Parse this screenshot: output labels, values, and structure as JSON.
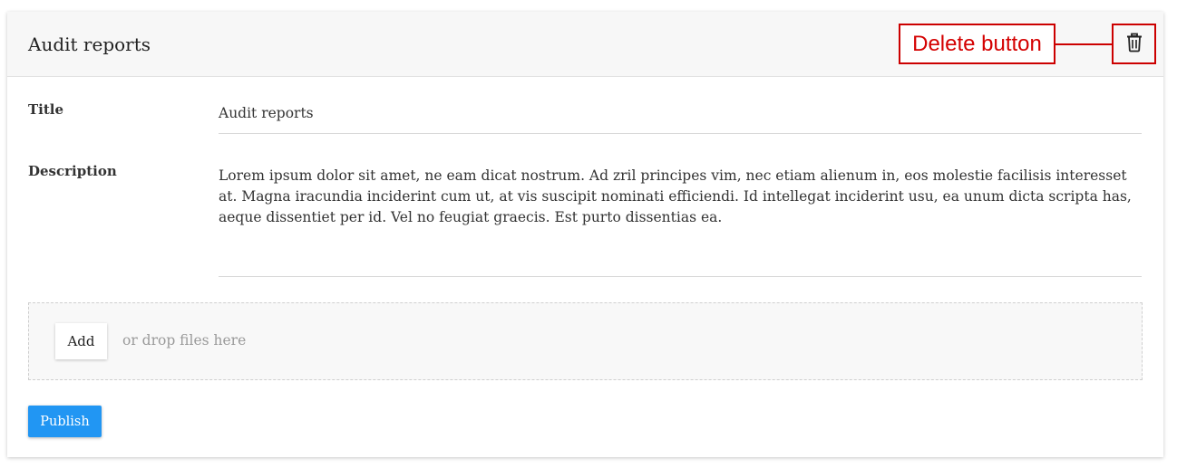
{
  "card": {
    "title": "Audit reports"
  },
  "annotation": {
    "label": "Delete button",
    "color": "#cc0000"
  },
  "toolbar": {
    "delete_icon": "trash-icon"
  },
  "form": {
    "title_label": "Title",
    "title_value": "Audit reports",
    "description_label": "Description",
    "description_value": "Lorem ipsum dolor sit amet, ne eam dicat nostrum. Ad zril principes vim, nec etiam alienum in, eos molestie facilisis interesset at. Magna iracundia inciderint cum ut, at vis suscipit nominati efficiendi. Id intellegat inciderint usu, ea unum dicta scripta has, aeque dissentiet per id. Vel no feugiat graecis. Est purto dissentias ea."
  },
  "attachments": {
    "add_label": "Add",
    "drop_hint": "or drop files here"
  },
  "actions": {
    "publish_label": "Publish",
    "publish_color": "#2196f3"
  }
}
